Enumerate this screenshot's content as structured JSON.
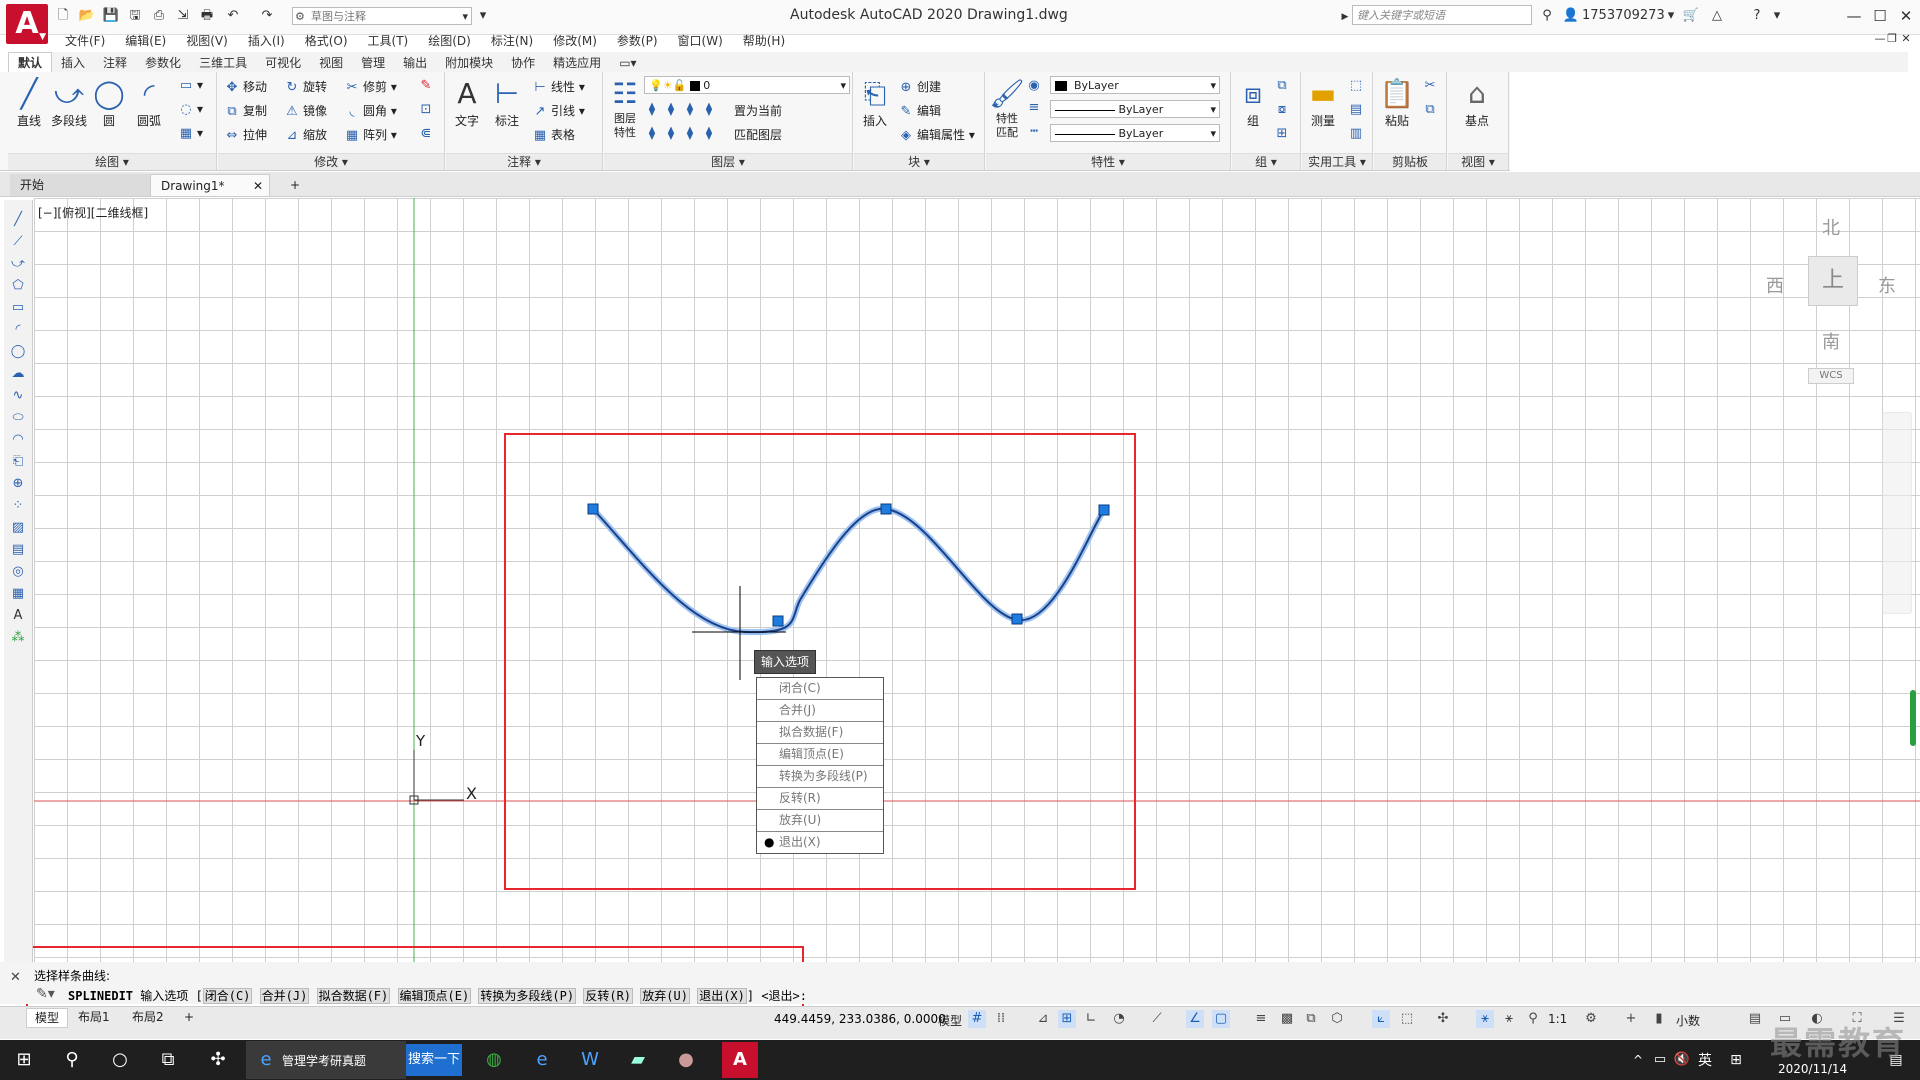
{
  "window": {
    "title": "Autodesk AutoCAD 2020    Drawing1.dwg",
    "workspace": "草图与注释",
    "search_placeholder": "键入关键字或短语",
    "user": "1753709273",
    "logo": "A"
  },
  "menu": [
    "文件(F)",
    "编辑(E)",
    "视图(V)",
    "插入(I)",
    "格式(O)",
    "工具(T)",
    "绘图(D)",
    "标注(N)",
    "修改(M)",
    "参数(P)",
    "窗口(W)",
    "帮助(H)"
  ],
  "ribbon_tabs": [
    "默认",
    "插入",
    "注释",
    "参数化",
    "三维工具",
    "可视化",
    "视图",
    "管理",
    "输出",
    "附加模块",
    "协作",
    "精选应用"
  ],
  "ribbon": {
    "draw": {
      "title": "绘图",
      "line": "直线",
      "polyline": "多段线",
      "circle": "圆",
      "arc": "圆弧"
    },
    "modify": {
      "title": "修改",
      "move": "移动",
      "rotate": "旋转",
      "trim": "修剪",
      "copy": "复制",
      "mirror": "镜像",
      "fillet": "圆角",
      "stretch": "拉伸",
      "scale": "缩放",
      "array": "阵列"
    },
    "annotation": {
      "title": "注释",
      "text": "文字",
      "dimension": "标注",
      "linear": "线性",
      "leader": "引线",
      "table": "表格"
    },
    "layers": {
      "title": "图层",
      "properties": "图层\n特性",
      "current_layer": "0",
      "set_current": "置为当前",
      "match_layer": "匹配图层"
    },
    "block": {
      "title": "块",
      "insert": "插入",
      "create": "创建",
      "edit": "编辑",
      "edit_attr": "编辑属性"
    },
    "properties": {
      "title": "特性",
      "match": "特性\n匹配",
      "color": "ByLayer",
      "linetype": "ByLayer",
      "lineweight": "ByLayer"
    },
    "group": {
      "title": "组",
      "group": "组"
    },
    "utilities": {
      "title": "实用工具",
      "measure": "测量"
    },
    "clipboard": {
      "title": "剪贴板",
      "paste": "粘贴"
    },
    "view": {
      "title": "视图",
      "base": "基点"
    }
  },
  "doc_tabs": {
    "start": "开始",
    "drawing": "Drawing1*",
    "add": "+"
  },
  "viewport_label": "[−][俯视][二维线框]",
  "viewcube": {
    "north": "北",
    "south": "南",
    "east": "东",
    "west": "西",
    "top": "上",
    "wcs": "WCS"
  },
  "ucs": {
    "x": "X",
    "y": "Y"
  },
  "prompt_tip": "输入选项",
  "option_menu": [
    "闭合(C)",
    "合并(J)",
    "拟合数据(F)",
    "编辑顶点(E)",
    "转换为多段线(P)",
    "反转(R)",
    "放弃(U)",
    "退出(X)"
  ],
  "option_selected": "退出(X)",
  "command": {
    "history": "选择样条曲线:",
    "cmd_name": "SPLINEDIT",
    "prompt": "输入选项",
    "options": [
      "闭合(C)",
      "合并(J)",
      "拟合数据(F)",
      "编辑顶点(E)",
      "转换为多段线(P)",
      "反转(R)",
      "放弃(U)",
      "退出(X)"
    ],
    "default": "<退出>:"
  },
  "layouts": [
    "模型",
    "布局1",
    "布局2",
    "+"
  ],
  "status": {
    "coords": "449.4459, 233.0386, 0.0000",
    "model": "模型",
    "scale": "1:1",
    "units": "小数"
  },
  "taskbar": {
    "ie_label": "管理学考研真题",
    "search_btn": "搜索一下",
    "lang": "英",
    "date": "2020/11/14"
  },
  "watermark": "最需教育",
  "colors": {
    "accent": "#c8102e",
    "annotation": "#e8262e",
    "spline": "#1c3f8a",
    "grip": "#1e7be0"
  }
}
